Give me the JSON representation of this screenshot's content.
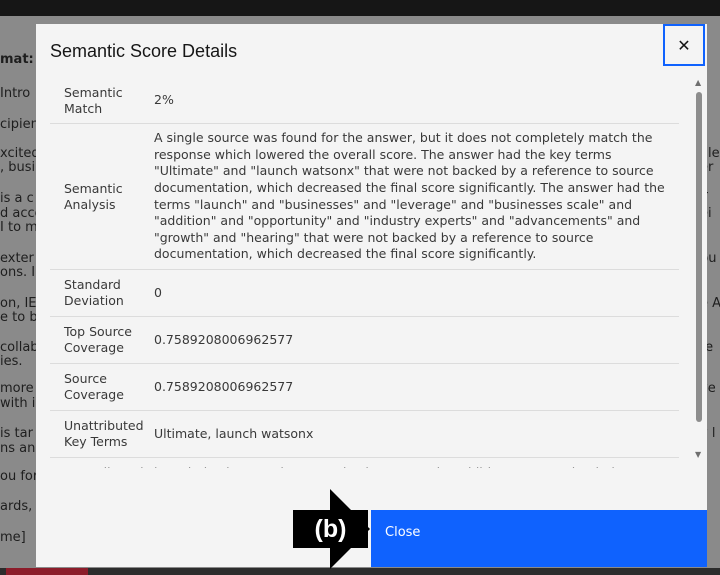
{
  "background": {
    "left_lines": [
      "mat:",
      "Intro",
      "cipien",
      "xcited",
      ", busi",
      "is a c",
      "d acco",
      "I to m",
      "exter",
      "ons. I",
      "on, IE",
      "e to b",
      "collab",
      "ies.",
      "more",
      "with i",
      "is tar",
      "ns an",
      "ou for",
      "ards,",
      "me]"
    ],
    "right_lines": [
      "ale",
      "er",
      "T",
      "ei",
      "bu",
      "e A",
      "te",
      "ve",
      "v l"
    ]
  },
  "modal": {
    "title": "Semantic Score Details",
    "close_icon": "close-icon",
    "rows": [
      {
        "label": "Semantic Match",
        "value": "2%"
      },
      {
        "label": "Semantic Analysis",
        "value": "A single source was found for the answer, but it does not completely match the response which lowered the overall score. The answer had the key terms \"Ultimate\" and \"launch watsonx\" that were not backed by a reference to source documentation, which decreased the final score significantly. The answer had the terms \"launch\" and \"businesses\" and \"leverage\" and \"businesses scale\" and \"addition\" and \"opportunity\" and \"industry experts\" and \"advancements\" and \"growth\" and \"hearing\" that were not backed by a reference to source documentation, which decreased the final score significantly."
      },
      {
        "label": "Standard Deviation",
        "value": "0"
      },
      {
        "label": "Top Source Coverage",
        "value": "0.7589208006962577"
      },
      {
        "label": "Source Coverage",
        "value": "0.7589208006962577"
      },
      {
        "label": "Unattributed Key Terms",
        "value": "Ultimate, launch watsonx"
      },
      {
        "label": "Unattributed",
        "value": "launch, businesses, leverage, businesses scale, addition, opportunity, industry"
      }
    ],
    "close_button": "Close"
  },
  "callout": {
    "label": "(b)"
  },
  "colors": {
    "accent": "#0f62fe",
    "modal_bg": "#f4f4f4"
  }
}
